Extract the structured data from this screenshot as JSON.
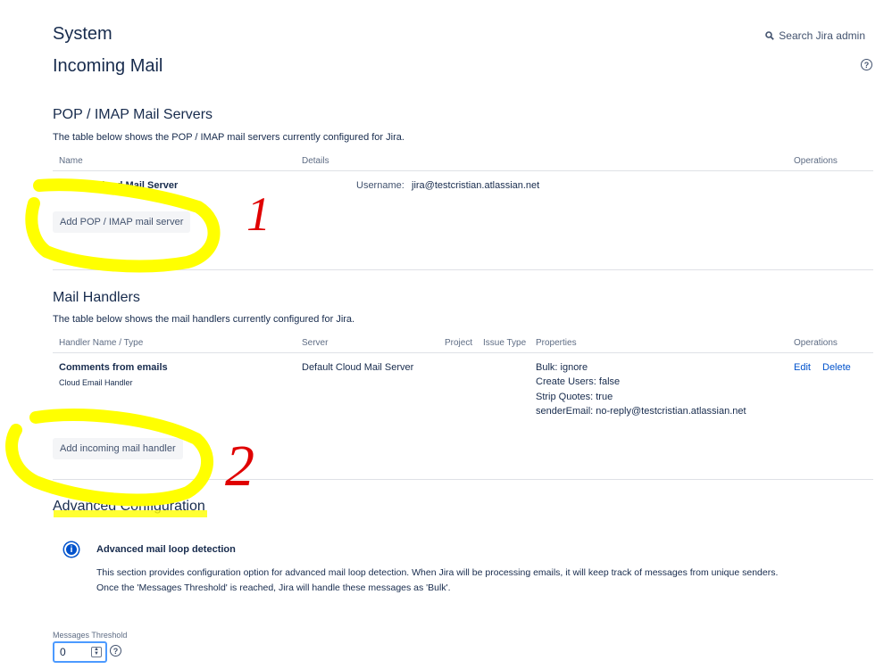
{
  "header": {
    "title": "System",
    "subtitle": "Incoming Mail",
    "search_label": "Search Jira admin",
    "help": "?"
  },
  "mail_servers": {
    "heading": "POP / IMAP Mail Servers",
    "description": "The table below shows the POP / IMAP mail servers currently configured for Jira.",
    "columns": {
      "name": "Name",
      "details": "Details",
      "operations": "Operations"
    },
    "rows": [
      {
        "name": "Default Cloud Mail Server",
        "details_label": "Username:",
        "details_value": "jira@testcristian.atlassian.net"
      }
    ],
    "add_button": "Add POP / IMAP mail server"
  },
  "mail_handlers": {
    "heading": "Mail Handlers",
    "description": "The table below shows the mail handlers currently configured for Jira.",
    "columns": {
      "handler": "Handler Name / Type",
      "server": "Server",
      "project": "Project",
      "issue_type": "Issue Type",
      "properties": "Properties",
      "operations": "Operations"
    },
    "rows": [
      {
        "name": "Comments from emails",
        "type": "Cloud Email Handler",
        "server": "Default Cloud Mail Server",
        "properties": [
          "Bulk: ignore",
          "Create Users: false",
          "Strip Quotes: true",
          "senderEmail: no-reply@testcristian.atlassian.net"
        ],
        "edit": "Edit",
        "delete": "Delete"
      }
    ],
    "add_button": "Add incoming mail handler"
  },
  "advanced": {
    "heading": "Advanced Configuration",
    "info_title": "Advanced mail loop detection",
    "info_line1": "This section provides configuration option for advanced mail loop detection. When Jira will be processing emails, it will keep track of messages from unique senders.",
    "info_line2": "Once the 'Messages Threshold' is reached, Jira will handle these messages as 'Bulk'.",
    "threshold_label": "Messages Threshold",
    "threshold_value": "0"
  },
  "annotations": {
    "marker_1": "1",
    "marker_2": "2",
    "highlight_color": "#ffff00",
    "marker_color": "#e00000"
  },
  "colors": {
    "link": "#0052cc",
    "text": "#172b4d",
    "muted": "#5e6c84"
  }
}
